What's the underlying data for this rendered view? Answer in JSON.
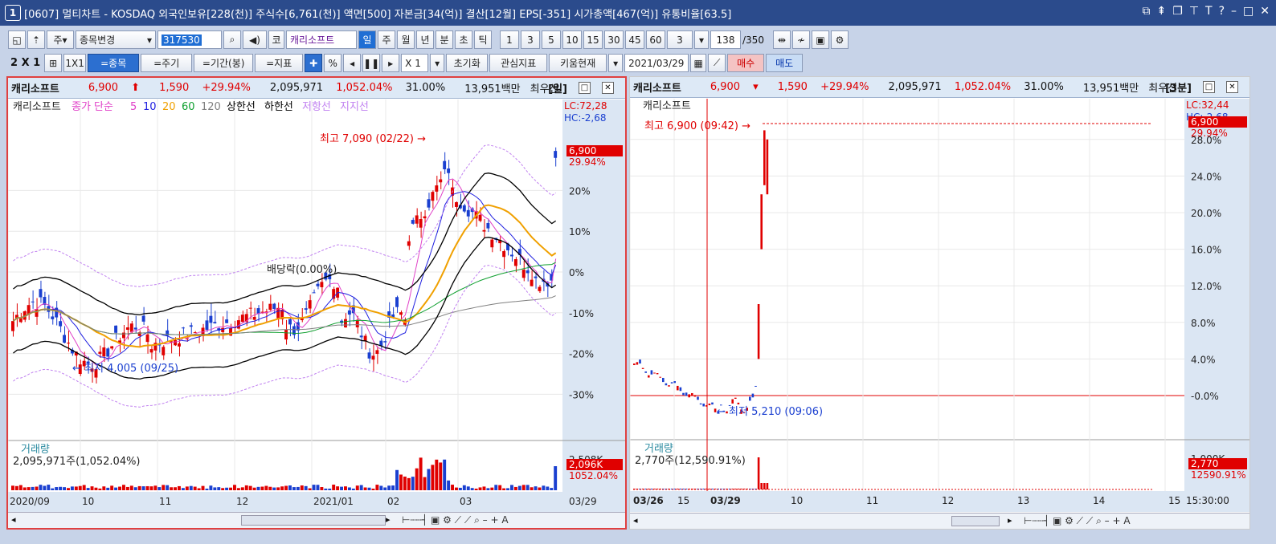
{
  "window": {
    "badge": "1",
    "title": "[0607] 멀티차트 - KOSDAQ 외국인보유[228(천)] 주식수[6,761(천)] 액면[500] 자본금[34(억)] 결산[12월] EPS[-351] 시가총액[467(억)] 유통비율[63.5]"
  },
  "toolbar1": {
    "period": "주",
    "stock_change": "종목변경",
    "code": "317530",
    "kor": "코",
    "name": "캐리소프트",
    "periods": [
      "일",
      "주",
      "월",
      "년",
      "분",
      "초",
      "틱"
    ],
    "nums": [
      "1",
      "3",
      "5",
      "10",
      "15",
      "30",
      "45",
      "60"
    ],
    "cnt": "3",
    "range": "138",
    "total": "/350"
  },
  "toolbar2": {
    "layout": "2 X 1",
    "one": "1X1",
    "b_stock": "=종목",
    "b_cycle": "=주기",
    "b_period": "=기간(봉)",
    "b_index": "=지표",
    "pct": "%",
    "mult": "X 1",
    "reset": "초기화",
    "interest": "관심지표",
    "kiwoom": "키움현재",
    "date": "2021/03/29",
    "buy": "매수",
    "sell": "매도"
  },
  "left": {
    "name": "캐리소프트",
    "price": "6,900",
    "change": "1,590",
    "rate": "+29.94%",
    "volume": "2,095,971",
    "volpct": "1,052.04%",
    "turn": "31.00%",
    "amount": "13,951백만",
    "type": "최우선",
    "cycle": "[일]",
    "legend": {
      "stock": "캐리소프트",
      "close": "종가 단순",
      "ma": [
        "5",
        "10",
        "20",
        "60",
        "120"
      ],
      "hi": "상한선",
      "lo": "하한선",
      "res": "저항선",
      "sup": "지지선"
    },
    "lc": "LC:72,28",
    "hc": "HC:-2,68",
    "tag_price": "6,900",
    "tag_rate": "29.94%",
    "yticks": [
      "20%",
      "10%",
      "0%",
      "-10%",
      "-20%",
      "-30%"
    ],
    "max_label": "최고 7,090 (02/22)",
    "min_label": "최저 4,005 (09/25)",
    "div_label": "배당락(0.00%)",
    "vol_title": "거래량",
    "vol_value": "2,095,971주(1,052.04%)",
    "vol_tick": "2,508K",
    "vol_tag": "2,096K",
    "vol_pct": "1052.04%",
    "xticks": [
      "2020/09",
      "10",
      "11",
      "12",
      "2021/01",
      "02",
      "03"
    ],
    "xend": "03/29"
  },
  "right": {
    "name": "캐리소프트",
    "price": "6,900",
    "change": "1,590",
    "rate": "+29.94%",
    "volume": "2,095,971",
    "volpct": "1,052.04%",
    "turn": "31.00%",
    "amount": "13,951백만",
    "type": "최우선",
    "cycle": "[3분]",
    "legend": {
      "stock": "캐리소프트"
    },
    "lc": "LC:32,44",
    "hc": "HC:-2,68",
    "tag_price": "6,900",
    "tag_rate": "29.94%",
    "yticks": [
      "28.0%",
      "24.0%",
      "20.0%",
      "16.0%",
      "12.0%",
      "8.0%",
      "4.0%",
      "-0.0%"
    ],
    "max_label": "최고 6,900 (09:42)",
    "min_label": "최저 5,210 (09:06)",
    "vol_title": "거래량",
    "vol_value": "2,770주(12,590.91%)",
    "vol_tick": "1,000K",
    "vol_tag": "2,770",
    "vol_pct": "12590.91%",
    "xticks": [
      "03/26",
      "15",
      "03/29",
      "10",
      "11",
      "12",
      "13",
      "14",
      "15"
    ],
    "xend": "15:30:00"
  },
  "colors": {
    "up": "#e00000",
    "down": "#1a3fd0",
    "ma5": "#e040c8",
    "ma10": "#2020e0",
    "ma20": "#f0a000",
    "ma60": "#10a030",
    "ma120": "#808080",
    "band": "#000000",
    "env": "#c080f0"
  }
}
